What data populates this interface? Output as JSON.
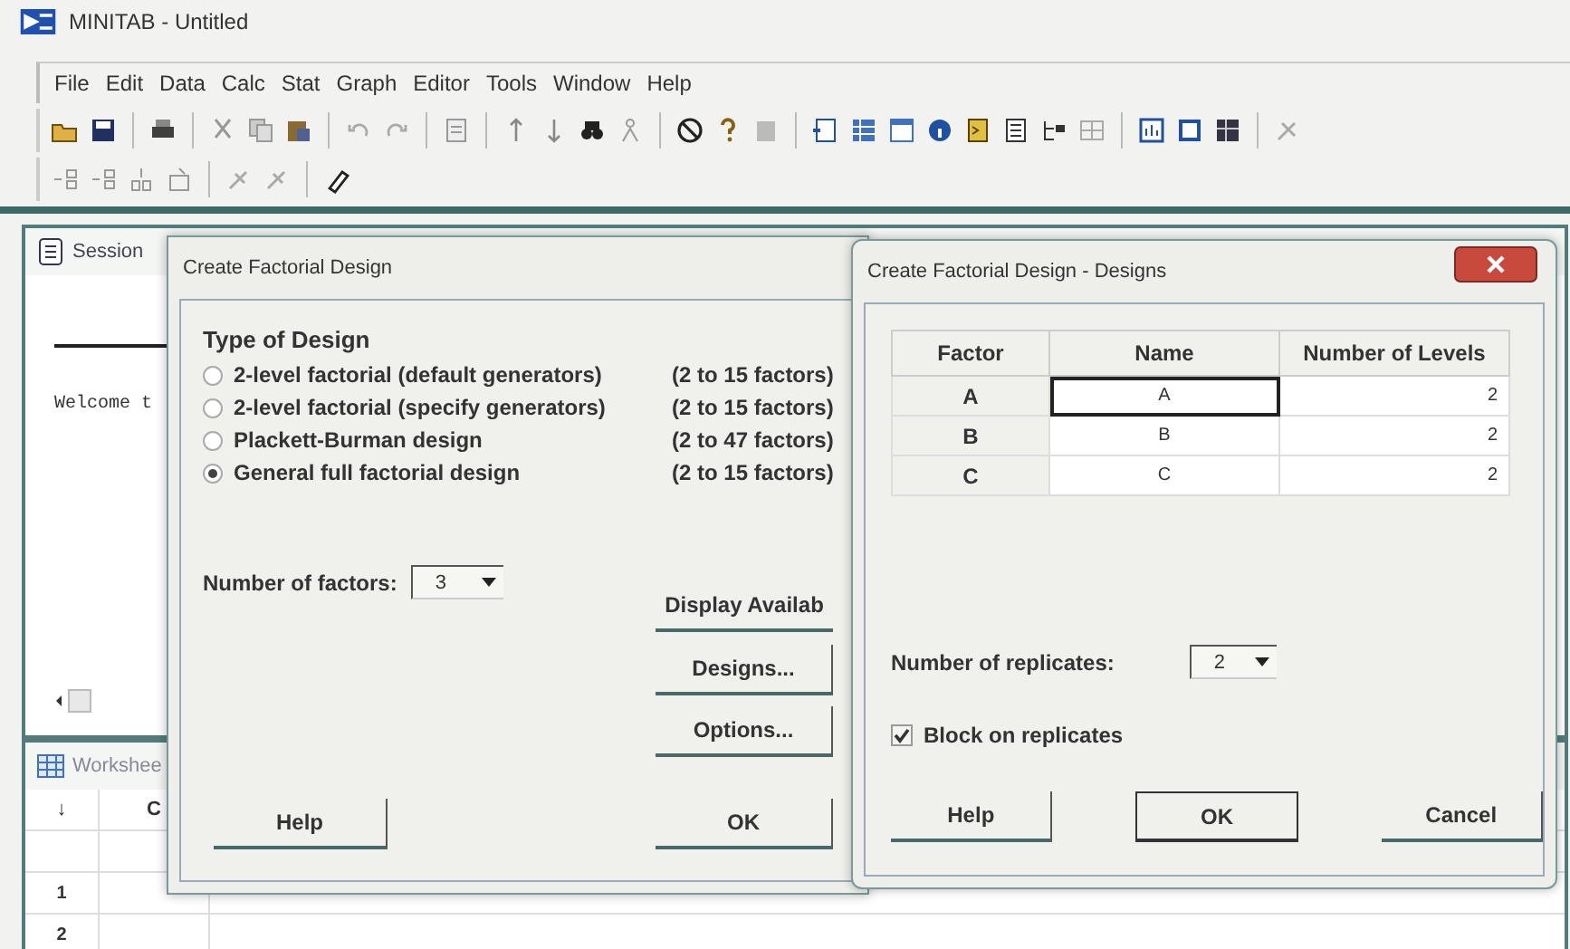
{
  "window": {
    "title": "MINITAB - Untitled"
  },
  "menu": [
    "File",
    "Edit",
    "Data",
    "Calc",
    "Stat",
    "Graph",
    "Editor",
    "Tools",
    "Window",
    "Help"
  ],
  "session": {
    "title": "Session",
    "text": "Welcome t"
  },
  "worksheet": {
    "title": "Workshee",
    "columns": [
      "↓",
      "C"
    ],
    "rows": [
      "1",
      "2"
    ]
  },
  "factorial_dialog": {
    "title": "Create Factorial Design",
    "section": "Type of Design",
    "design_types": [
      {
        "label": "2-level factorial (default generators)",
        "range": "(2 to 15 factors)",
        "selected": false
      },
      {
        "label": "2-level factorial (specify generators)",
        "range": "(2 to 15 factors)",
        "selected": false
      },
      {
        "label": "Plackett-Burman design",
        "range": "(2 to 47 factors)",
        "selected": false
      },
      {
        "label": "General full factorial design",
        "range": "(2 to 15 factors)",
        "selected": true
      }
    ],
    "factors_label": "Number of factors:",
    "factors_value": "3",
    "side_buttons": [
      "Display Availab",
      "Designs...",
      "Options..."
    ],
    "bottom_buttons": [
      "Help",
      "OK"
    ]
  },
  "designs_dialog": {
    "title": "Create Factorial Design - Designs",
    "table": {
      "columns": [
        "Factor",
        "Name",
        "Number of Levels"
      ],
      "rows": [
        {
          "factor": "A",
          "name": "A",
          "levels": "2",
          "selected": true
        },
        {
          "factor": "B",
          "name": "B",
          "levels": "2",
          "selected": false
        },
        {
          "factor": "C",
          "name": "C",
          "levels": "2",
          "selected": false
        }
      ]
    },
    "replicates_label": "Number of replicates:",
    "replicates_value": "2",
    "block_checkbox": {
      "label": "Block on replicates",
      "checked": true
    },
    "buttons": [
      {
        "label": "Help",
        "default": false
      },
      {
        "label": "OK",
        "default": true
      },
      {
        "label": "Cancel",
        "default": false
      }
    ]
  }
}
